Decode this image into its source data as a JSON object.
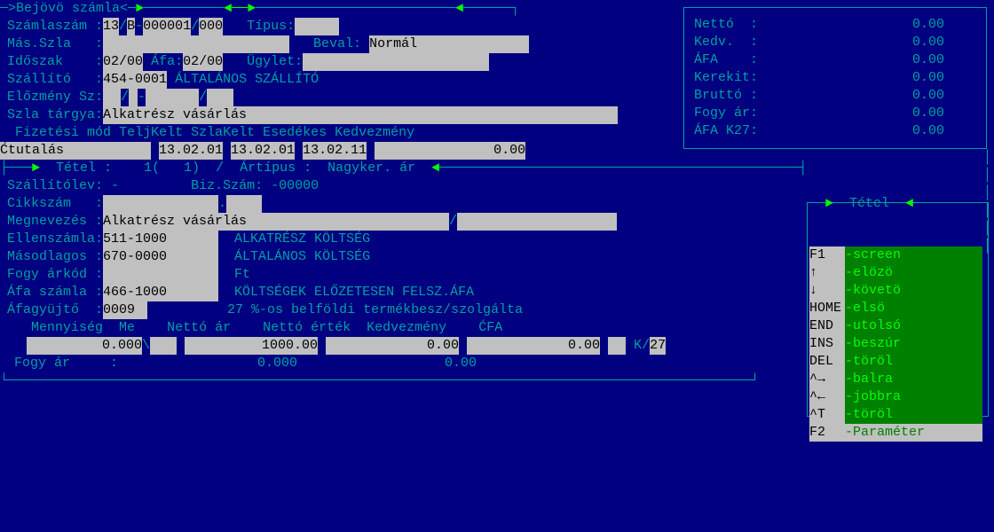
{
  "title": "Bejövö számla",
  "f": {
    "szamlaszam": "Számlaszám :",
    "masszla": "Más.Szla   :",
    "idoszak": "Időszak    :",
    "afa": "Áfa:",
    "szallito": "Szállító   :",
    "elozmeny": "Előzmény Sz:",
    "targy": "Szla tárgya:",
    "tipus": "Típus:",
    "beval": "Beval:",
    "ugylet": "Ügylet:",
    "fizmod": "Fizetési mód",
    "teljkelt": "TeljKelt",
    "szlakelt": "SzlaKelt",
    "esedekes": "Esedékes",
    "kedvezmeny": "Kedvezmény",
    "tetel": "Tétel :",
    "artipus": "Ártípus :",
    "szallitolev": "Szállítólev:",
    "bizszam": "Biz.Szám:",
    "cikkszam": "Cikkszám   :",
    "megnevezes": "Megnevezés :",
    "ellenszamla": "Ellenszámla:",
    "masodlagos": "Másodlagos :",
    "fogyarkod": "Fogy árkód :",
    "afaszamla": "Áfa számla :",
    "afagyujto": "Áfagyüjtő  :",
    "mennyiseg": "Mennyiség",
    "me": "Me",
    "nettoar": "Nettó ár",
    "nettoertek": "Nettó érték",
    "kedv2": "Kedvezmény",
    "cfa": "ĆFA",
    "fogyar": "Fogy ár     :"
  },
  "v": {
    "sz1": "13",
    "sz2": "B",
    "sz3": "000001",
    "sz4": "000",
    "ido1": "02/00",
    "ido2": "02/00",
    "szallkod": "454-0001",
    "szallnev": "ÁLTALÁNOS SZÁLLÍTÓ",
    "targy": "Alkatrész vásárlás",
    "fizmod": "Ćtutalás",
    "telj": "13.02.01",
    "szlak": "13.02.01",
    "esed": "13.02.11",
    "kedv": "0.00",
    "beval": "Normál",
    "tetelno": "1(   1)",
    "artipus": "Nagyker. ár",
    "szlev": "-",
    "bizszam": "-00000",
    "megn": "Alkatrész vásárlás",
    "ell": "511-1000",
    "ellnev": "ALKATRÉSZ KÖLTSÉG",
    "mas": "670-0000",
    "masnev": "ÁLTALÁNOS KÖLTSÉG",
    "ft": "Ft",
    "afasz": "466-1000",
    "afasznev": "KÖLTSÉGEK ELŐZETESEN FELSZ.ÁFA",
    "afagy": "0009",
    "afagynev": "27 %-os belföldi termékbesz/szolgálta",
    "menny": "0.000",
    "nar": "1000.00",
    "nert": "0.00",
    "kedv2": "0.00",
    "k": "K",
    "afa27": "27",
    "far1": "0.000",
    "far2": "0.00"
  },
  "tot": {
    "netto": "Nettó  :",
    "nettov": "0.00",
    "kedv": "Kedv.  :",
    "kedvv": "0.00",
    "afa": "ÁFA    :",
    "afav": "0.00",
    "kerekit": "Kerekit:",
    "kerekitv": "0.00",
    "brutto": "Bruttó :",
    "bruttov": "0.00",
    "fogy": "Fogy ár:",
    "fogyv": "0.00",
    "afak": "ÁFA K27:",
    "afakv": "0.00"
  },
  "help": {
    "title": "Tétel",
    "k": [
      "F1",
      "↑",
      "↓",
      "HOME",
      "END",
      "INS",
      "DEL",
      "^→",
      "^←",
      "^T",
      "F2"
    ],
    "d": [
      "-screen",
      "-elözö",
      "-követö",
      "-elsö",
      "-utolsó",
      "-beszúr",
      "-töröl",
      "-balra",
      "-jobbra",
      "-töröl",
      "-Paraméter"
    ]
  }
}
